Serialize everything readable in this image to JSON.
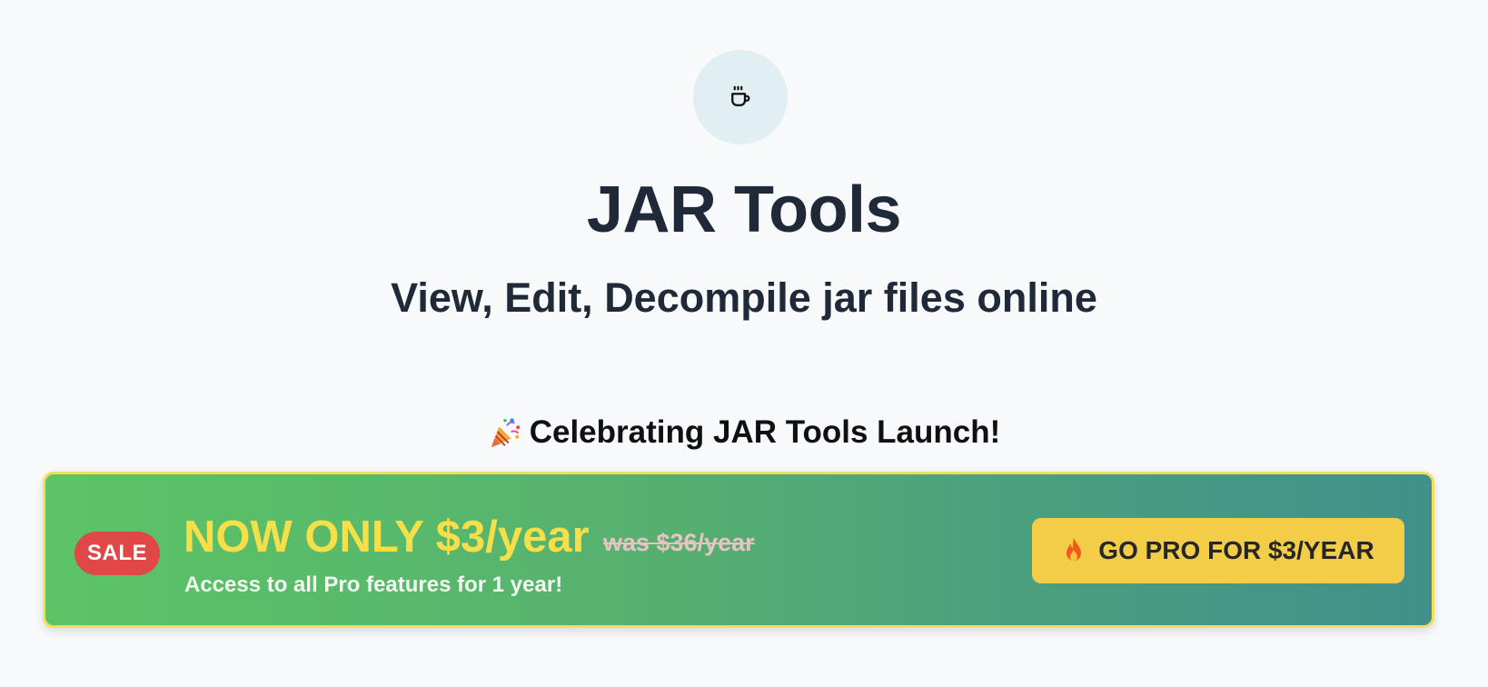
{
  "header": {
    "logo_icon": "coffee-cup-icon",
    "title": "JAR Tools",
    "subtitle": "View, Edit, Decompile jar files online"
  },
  "promo": {
    "headline_icon": "party-popper-icon",
    "headline": "Celebrating JAR Tools Launch!",
    "badge": "SALE",
    "price": "NOW ONLY $3/year",
    "was_price": "was $36/year",
    "note": "Access to all Pro features for 1 year!",
    "cta_icon": "fire-icon",
    "cta_label": "GO PRO FOR $3/YEAR"
  },
  "colors": {
    "background": "#f7f9fb",
    "title_text": "#1f2937",
    "banner_gradient_start": "#5cc466",
    "banner_gradient_end": "#41908a",
    "banner_border": "#f5dd5a",
    "price_text": "#f7df4a",
    "sale_badge": "#e04848",
    "cta_button": "#f3cd48"
  }
}
